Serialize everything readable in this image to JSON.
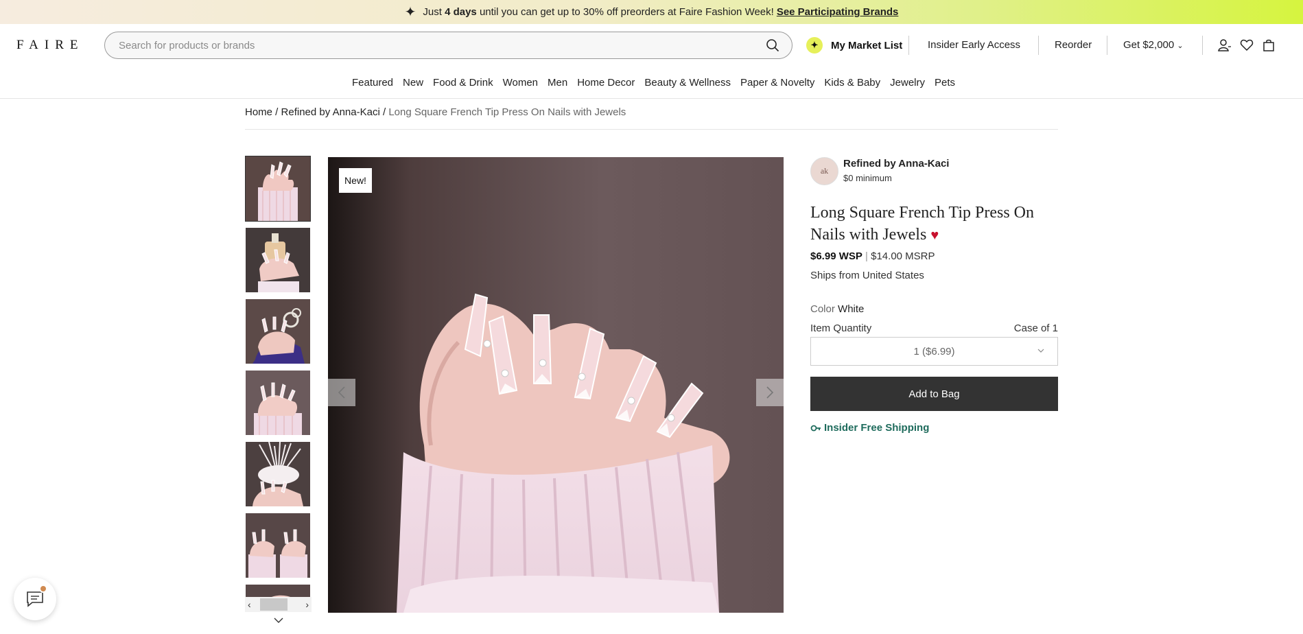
{
  "promo": {
    "prefix": "Just",
    "bold": "4 days",
    "text": "until you can get up to 30% off preorders at Faire Fashion Week!",
    "link": "See Participating Brands"
  },
  "header": {
    "logo": "FAIRE",
    "search_placeholder": "Search for products or brands",
    "my_market_list": "My Market List",
    "insider_early_access": "Insider Early Access",
    "reorder": "Reorder",
    "get_credit": "Get $2,000"
  },
  "categories": [
    "Featured",
    "New",
    "Food & Drink",
    "Women",
    "Men",
    "Home Decor",
    "Beauty & Wellness",
    "Paper & Novelty",
    "Kids & Baby",
    "Jewelry",
    "Pets"
  ],
  "breadcrumb": {
    "home": "Home",
    "sep": " / ",
    "brand": "Refined by Anna-Kaci",
    "current": "Long Square French Tip Press On Nails with Jewels"
  },
  "product": {
    "badge": "New!",
    "brand_name": "Refined by Anna-Kaci",
    "brand_logo_text": "ak",
    "brand_minimum": "$0 minimum",
    "title": "Long Square French Tip Press On Nails with Jewels",
    "wsp": "$6.99 WSP",
    "price_sep": "|",
    "msrp": "$14.00 MSRP",
    "ships_from": "Ships from United States",
    "color_label": "Color",
    "color_value": "White",
    "quantity_label": "Item Quantity",
    "case_of": "Case of 1",
    "quantity_selected": "1 ($6.99)",
    "add_to_bag": "Add to Bag",
    "insider_shipping": "Insider Free Shipping"
  },
  "colors": {
    "insider_green": "#1e6b5c",
    "button_dark": "#333333",
    "heart_red": "#c8102e"
  }
}
